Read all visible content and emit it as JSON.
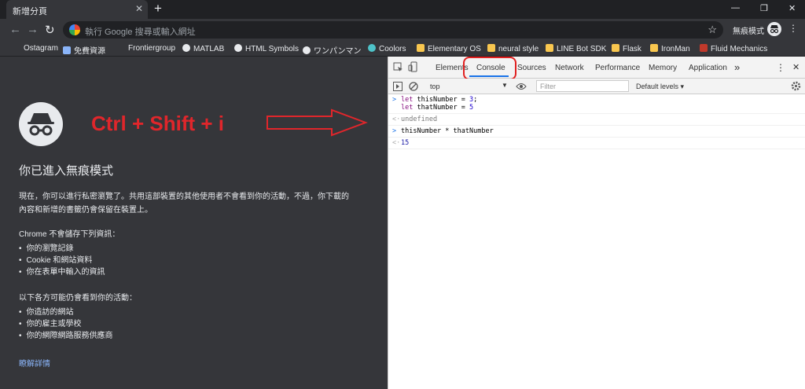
{
  "tab": {
    "title": "新增分頁",
    "close": "✕",
    "new": "+"
  },
  "window": {
    "minimize": "—",
    "restore": "❐",
    "close": "✕"
  },
  "nav": {
    "back": "←",
    "forward": "→",
    "reload": "↻"
  },
  "omnibox": {
    "placeholder": "執行 Google 搜尋或輸入網址",
    "star": "☆"
  },
  "profile": {
    "label": "無痕模式",
    "menu": "⋮"
  },
  "bookmarks": [
    {
      "label": "Ostagram",
      "icon": "none"
    },
    {
      "label": "免費資源",
      "icon": "site-icon"
    },
    {
      "label": "Frontiergroup",
      "icon": "none"
    },
    {
      "label": "MATLAB",
      "icon": "globe-icon"
    },
    {
      "label": "HTML Symbols",
      "icon": "globe-icon"
    },
    {
      "label": "ワンパンマン",
      "icon": "globe-icon"
    },
    {
      "label": "Coolors",
      "icon": "coolors-icon"
    },
    {
      "label": "Elementary OS",
      "icon": "folder-icon"
    },
    {
      "label": "neural style",
      "icon": "folder-icon"
    },
    {
      "label": "LINE Bot SDK",
      "icon": "folder-icon"
    },
    {
      "label": "Flask",
      "icon": "folder-icon"
    },
    {
      "label": "IronMan",
      "icon": "folder-icon"
    },
    {
      "label": "Fluid Mechanics",
      "icon": "n-icon"
    }
  ],
  "incognito": {
    "annotation": "Ctrl + Shift + i",
    "title": "你已進入無痕模式",
    "intro_line1": "現在，你可以進行私密瀏覽了。共用這部裝置的其他使用者不會看到你的活動，不過，你下載的",
    "intro_line2": "內容和新增的書籤仍會保留在裝置上。",
    "not_saved_heading": "Chrome 不會儲存下列資訊：",
    "not_saved": [
      "你的瀏覽記錄",
      "Cookie 和網站資料",
      "你在表單中輸入的資訊"
    ],
    "visible_heading": "以下各方可能仍會看到你的活動：",
    "visible_to": [
      "你造訪的網站",
      "你的雇主或學校",
      "你的網際網路服務供應商"
    ],
    "learn_more": "瞭解詳情"
  },
  "devtools": {
    "tabs": [
      "Elements",
      "Console",
      "Sources",
      "Network",
      "Performance",
      "Memory",
      "Application"
    ],
    "more": "»",
    "menu": "⋮",
    "close": "✕",
    "context": "top",
    "filter_placeholder": "Filter",
    "levels": "Default levels ▾",
    "console": {
      "in1_kw1": "let",
      "in1_rest1": " thisNumber = ",
      "in1_val1": "3",
      "in1_end1": ";",
      "in1_kw2": "let",
      "in1_rest2": " thatNumber = ",
      "in1_val2": "5",
      "out1": "undefined",
      "in2": "thisNumber * thatNumber",
      "out2": "15",
      "prompt_in": ">",
      "prompt_out": "<·"
    }
  },
  "colors": {
    "annotation": "#e0262b",
    "accent": "#1a73e8",
    "page_bg": "#35363a"
  }
}
